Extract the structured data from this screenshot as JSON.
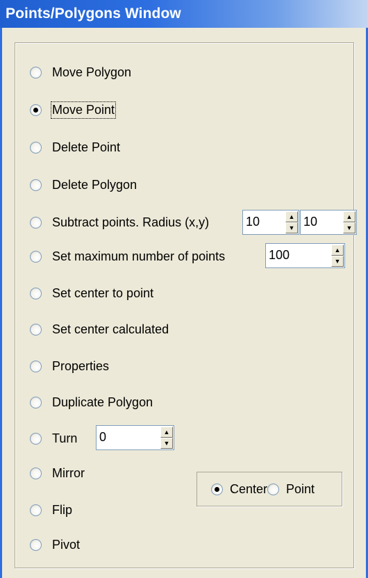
{
  "window": {
    "title": "Points/Polygons Window"
  },
  "options": [
    {
      "label": "Move Polygon",
      "checked": false
    },
    {
      "label": "Move Point",
      "checked": true
    },
    {
      "label": "Delete Point",
      "checked": false
    },
    {
      "label": "Delete Polygon",
      "checked": false
    },
    {
      "label": "Subtract points. Radius (x,y)",
      "checked": false
    },
    {
      "label": "Set maximum number of points",
      "checked": false
    },
    {
      "label": "Set center to point",
      "checked": false
    },
    {
      "label": "Set center calculated",
      "checked": false
    },
    {
      "label": "Properties",
      "checked": false
    },
    {
      "label": "Duplicate Polygon",
      "checked": false
    },
    {
      "label": "Turn",
      "checked": false
    },
    {
      "label": "Mirror",
      "checked": false
    },
    {
      "label": "Flip",
      "checked": false
    },
    {
      "label": "Pivot",
      "checked": false
    }
  ],
  "spinners": {
    "radius_x": "10",
    "radius_y": "10",
    "max_points": "100",
    "turn": "0"
  },
  "pivot_mode": {
    "center_label": "Center",
    "point_label": "Point",
    "selected": "Center"
  }
}
